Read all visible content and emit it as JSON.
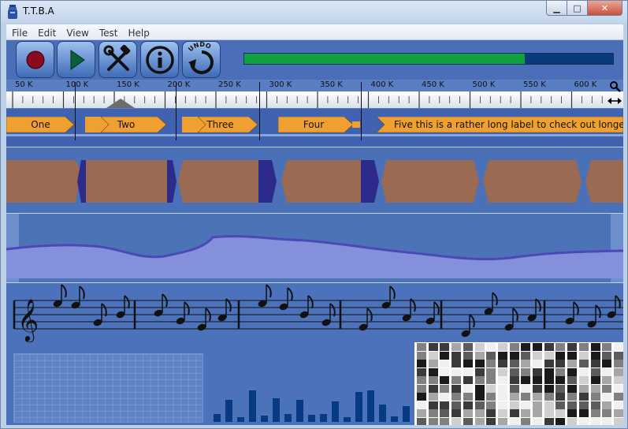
{
  "window": {
    "title": "T.T.B.A",
    "min_glyph": "▁",
    "max_glyph": "□",
    "close_glyph": "✕"
  },
  "menu": [
    "File",
    "Edit",
    "View",
    "Test",
    "Help"
  ],
  "toolbar": {
    "buttons": [
      {
        "name": "record-button",
        "icon": "record-icon"
      },
      {
        "name": "play-button",
        "icon": "play-icon"
      },
      {
        "name": "settings-button",
        "icon": "tools-icon"
      },
      {
        "name": "info-button",
        "icon": "info-icon"
      },
      {
        "name": "undo-button",
        "icon": "undo-icon",
        "label": "UNDO"
      }
    ],
    "progress": 0.76,
    "colors": {
      "progress_fill": "#0fa040",
      "progress_track": "#0a3a7a"
    }
  },
  "ruler": {
    "labels": [
      "50 K",
      "100 K",
      "150 K",
      "200 K",
      "250 K",
      "300 K",
      "350 K",
      "400 K",
      "450 K",
      "500 K",
      "550 K",
      "600 K"
    ],
    "zoom_icon": "magnifier-icon",
    "fit_icon": "horizontal-arrows-icon"
  },
  "label_track": {
    "labels": [
      "One",
      "Two",
      "Three",
      "Four",
      "Five this is a rather long label to check out longer labels"
    ],
    "color": "#f0a030"
  },
  "clip_track": {
    "clip_color": "#9a6b52",
    "overlap_color": "#2c2a8a"
  },
  "envelope_track": {
    "fill": "#7d86d6",
    "line": "#4a49b5"
  },
  "note_track": {
    "clef": "𝄞"
  },
  "grayscale_track": {
    "columns": 18
  }
}
